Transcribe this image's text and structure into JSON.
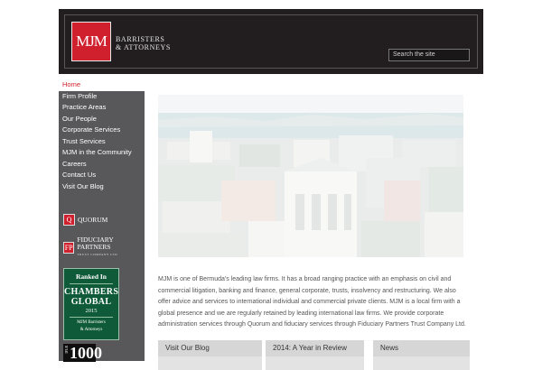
{
  "header": {
    "logo_mark": "MJM",
    "logo_line1": "BARRISTERS",
    "logo_line2": "& ATTORNEYS",
    "search_placeholder": "Search the site"
  },
  "nav": {
    "items": [
      {
        "label": "Home",
        "active": true
      },
      {
        "label": "Firm Profile"
      },
      {
        "label": "Practice Areas"
      },
      {
        "label": "Our People"
      },
      {
        "label": "Corporate Services"
      },
      {
        "label": "Trust Services"
      },
      {
        "label": "MJM in the Community"
      },
      {
        "label": "Careers"
      },
      {
        "label": "Contact Us"
      },
      {
        "label": "Visit Our Blog"
      }
    ]
  },
  "partners": {
    "quorum": {
      "mark": "Q",
      "name": "QUORUM"
    },
    "fiduciary": {
      "mark": "FP",
      "name": "FIDUCIARY PARTNERS",
      "sub": "TRUST COMPANY LTD"
    }
  },
  "chambers": {
    "ranked": "Ranked In",
    "line1": "CHAMBERS",
    "line2": "GLOBAL",
    "year": "2015",
    "firm1": "MJM Barristers",
    "firm2": "& Attorneys"
  },
  "ifl": {
    "label": "IFLR",
    "number": "1000"
  },
  "intro": "MJM is one of Bermuda's leading law firms. It has a broad ranging practice with an emphasis on civil and commercial litigation, banking and finance, general corporate, trusts, insolvency and restructuring. We also offer advice and services to international individual and commercial private clients. MJM is a local firm with a global presence and we are regularly retained by leading international law firms. We provide corporate administration services through Quorum and fiduciary services through Fiduciary Partners Trust Company Ltd.",
  "boxes": [
    {
      "title": "Visit Our Blog"
    },
    {
      "title": "2014: A Year in Review"
    },
    {
      "title": "News"
    }
  ],
  "colors": {
    "brand_red": "#d0202e",
    "header_dark": "#221e1f",
    "sidebar_gray": "#58585a",
    "chambers_green": "#0f5a38"
  }
}
